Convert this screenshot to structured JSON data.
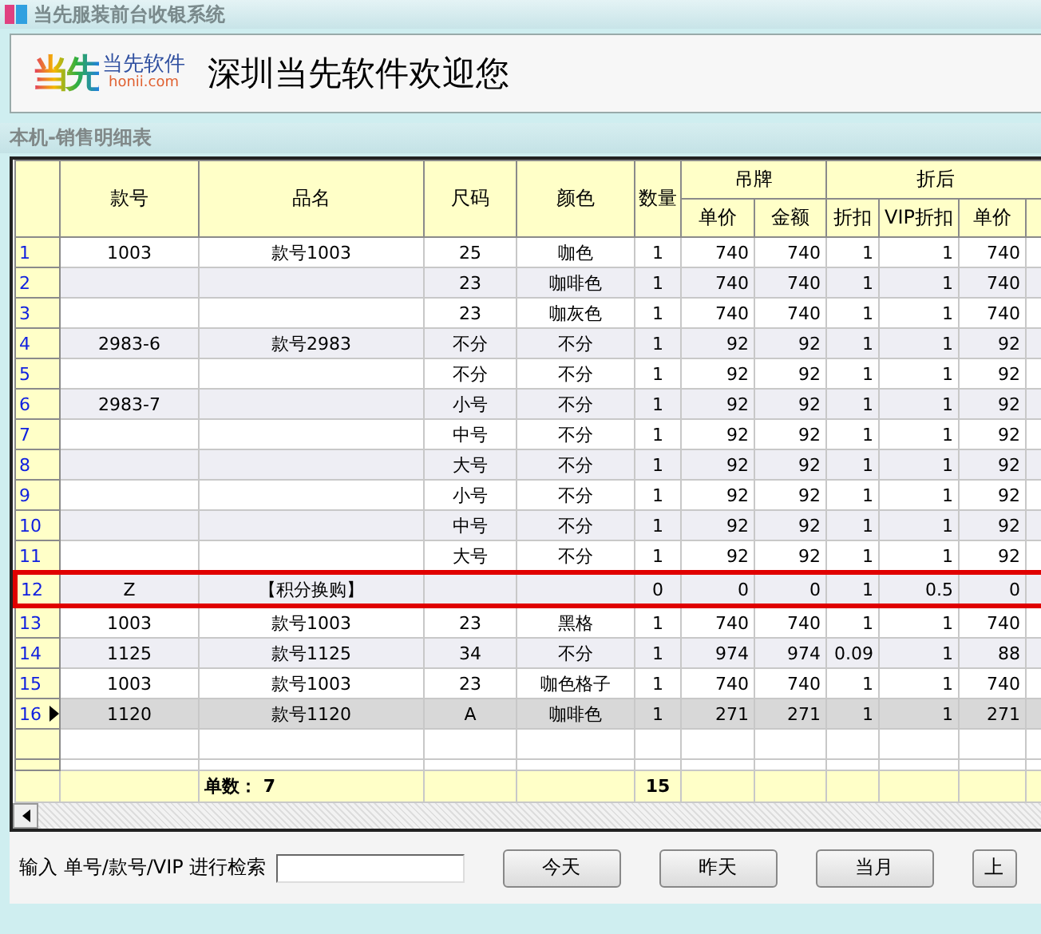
{
  "window": {
    "title": "当先服装前台收银系统"
  },
  "banner": {
    "logo_mark": "当先",
    "logo_name": "当先软件",
    "logo_site": "honii.com",
    "welcome": "深圳当先软件欢迎您"
  },
  "section": {
    "title": "本机-销售明细表"
  },
  "table": {
    "columns": [
      "款号",
      "品名",
      "尺码",
      "颜色",
      "数量"
    ],
    "groups": [
      {
        "label": "吊牌",
        "columns": [
          "单价",
          "金额"
        ]
      },
      {
        "label": "折后",
        "columns": [
          "折扣",
          "VIP折扣",
          "单价"
        ]
      }
    ],
    "rows": [
      {
        "no": "1",
        "style_no": "1003",
        "product_name": "款号1003",
        "size": "25",
        "colour": "咖色",
        "qty": "1",
        "tag_price": "740",
        "tag_amount": "740",
        "discount": "1",
        "vip_discount": "1",
        "net_price": "740",
        "selected": false,
        "highlighted": false
      },
      {
        "no": "2",
        "size": "23",
        "colour": "咖啡色",
        "qty": "1",
        "tag_price": "740",
        "tag_amount": "740",
        "discount": "1",
        "vip_discount": "1",
        "net_price": "740",
        "selected": false,
        "highlighted": false
      },
      {
        "no": "3",
        "size": "23",
        "colour": "咖灰色",
        "qty": "1",
        "tag_price": "740",
        "tag_amount": "740",
        "discount": "1",
        "vip_discount": "1",
        "net_price": "740",
        "selected": false,
        "highlighted": false
      },
      {
        "no": "4",
        "style_no": "2983-6",
        "product_name": "款号2983",
        "size": "不分",
        "colour": "不分",
        "qty": "1",
        "tag_price": "92",
        "tag_amount": "92",
        "discount": "1",
        "vip_discount": "1",
        "net_price": "92",
        "selected": false,
        "highlighted": false
      },
      {
        "no": "5",
        "size": "不分",
        "colour": "不分",
        "qty": "1",
        "tag_price": "92",
        "tag_amount": "92",
        "discount": "1",
        "vip_discount": "1",
        "net_price": "92",
        "selected": false,
        "highlighted": false
      },
      {
        "no": "6",
        "style_no": "2983-7",
        "size": "小号",
        "colour": "不分",
        "qty": "1",
        "tag_price": "92",
        "tag_amount": "92",
        "discount": "1",
        "vip_discount": "1",
        "net_price": "92",
        "selected": false,
        "highlighted": false
      },
      {
        "no": "7",
        "size": "中号",
        "colour": "不分",
        "qty": "1",
        "tag_price": "92",
        "tag_amount": "92",
        "discount": "1",
        "vip_discount": "1",
        "net_price": "92",
        "selected": false,
        "highlighted": false
      },
      {
        "no": "8",
        "size": "大号",
        "colour": "不分",
        "qty": "1",
        "tag_price": "92",
        "tag_amount": "92",
        "discount": "1",
        "vip_discount": "1",
        "net_price": "92",
        "selected": false,
        "highlighted": false
      },
      {
        "no": "9",
        "size": "小号",
        "colour": "不分",
        "qty": "1",
        "tag_price": "92",
        "tag_amount": "92",
        "discount": "1",
        "vip_discount": "1",
        "net_price": "92",
        "selected": false,
        "highlighted": false
      },
      {
        "no": "10",
        "size": "中号",
        "colour": "不分",
        "qty": "1",
        "tag_price": "92",
        "tag_amount": "92",
        "discount": "1",
        "vip_discount": "1",
        "net_price": "92",
        "selected": false,
        "highlighted": false
      },
      {
        "no": "11",
        "size": "大号",
        "colour": "不分",
        "qty": "1",
        "tag_price": "92",
        "tag_amount": "92",
        "discount": "1",
        "vip_discount": "1",
        "net_price": "92",
        "selected": false,
        "highlighted": false
      },
      {
        "no": "12",
        "style_no": "Z",
        "product_name": "【积分换购】",
        "qty": "0",
        "tag_price": "0",
        "tag_amount": "0",
        "discount": "1",
        "vip_discount": "0.5",
        "net_price": "0",
        "selected": false,
        "highlighted": true
      },
      {
        "no": "13",
        "style_no": "1003",
        "product_name": "款号1003",
        "size": "23",
        "colour": "黑格",
        "qty": "1",
        "tag_price": "740",
        "tag_amount": "740",
        "discount": "1",
        "vip_discount": "1",
        "net_price": "740",
        "selected": false,
        "highlighted": false
      },
      {
        "no": "14",
        "style_no": "1125",
        "product_name": "款号1125",
        "size": "34",
        "colour": "不分",
        "qty": "1",
        "tag_price": "974",
        "tag_amount": "974",
        "discount": "0.09",
        "vip_discount": "1",
        "net_price": "88",
        "selected": false,
        "highlighted": false
      },
      {
        "no": "15",
        "style_no": "1003",
        "product_name": "款号1003",
        "size": "23",
        "colour": "咖色格子",
        "qty": "1",
        "tag_price": "740",
        "tag_amount": "740",
        "discount": "1",
        "vip_discount": "1",
        "net_price": "740",
        "selected": false,
        "highlighted": false
      },
      {
        "no": "16",
        "style_no": "1120",
        "product_name": "款号1120",
        "size": "A",
        "colour": "咖啡色",
        "qty": "1",
        "tag_price": "271",
        "tag_amount": "271",
        "discount": "1",
        "vip_discount": "1",
        "net_price": "271",
        "selected": true,
        "highlighted": false
      }
    ],
    "totals": {
      "order_count": "单数： 7",
      "qty": "15"
    }
  },
  "search": {
    "label": "输入 单号/款号/VIP 进行检索"
  },
  "buttons": [
    "今天",
    "昨天",
    "当月",
    "上"
  ]
}
